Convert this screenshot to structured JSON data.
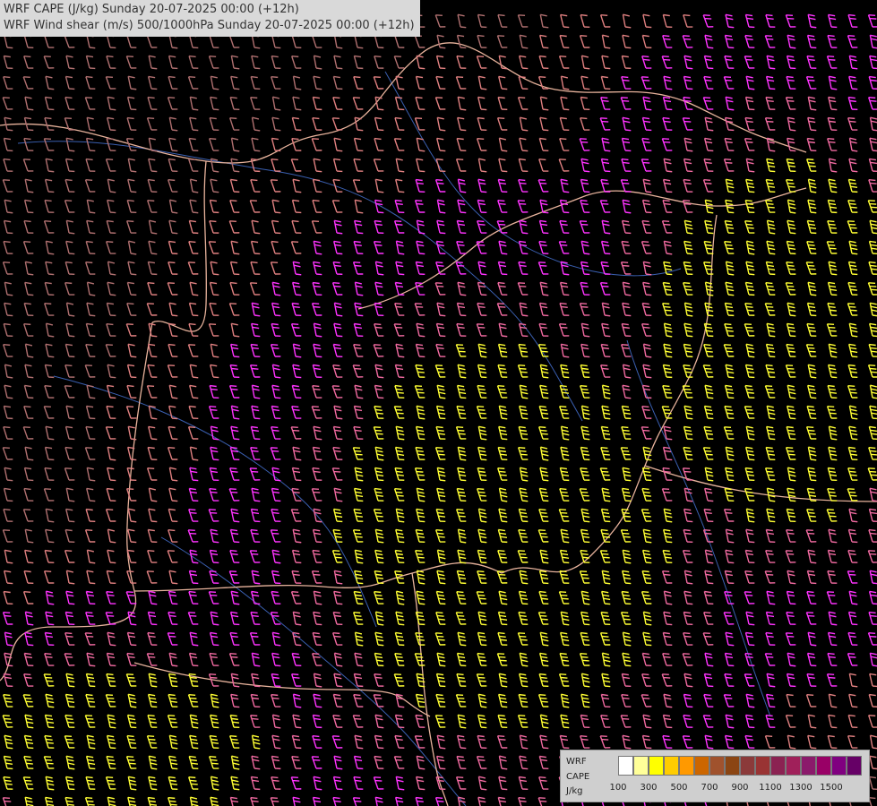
{
  "titles": {
    "line1": "WRF CAPE (J/kg) Sunday 20-07-2025 00:00 (+12h)",
    "line2": "WRF Wind shear (m/s) 500/1000hPa Sunday 20-07-2025 00:00 (+12h)"
  },
  "legend": {
    "label_lines": [
      "WRF",
      "CAPE",
      "J/kg"
    ],
    "colors": [
      "#ffffff",
      "#ffff99",
      "#ffff00",
      "#ffcc00",
      "#ff9900",
      "#cc6600",
      "#a0522d",
      "#8b4513",
      "#8b3a3a",
      "#993333",
      "#8b2252",
      "#a0205a",
      "#8b1a6b",
      "#990066",
      "#800080",
      "#660066"
    ],
    "tick_labels": [
      "100",
      "300",
      "500",
      "700",
      "900",
      "1100",
      "1300",
      "1500"
    ]
  },
  "map_style": {
    "background": "#000000",
    "border_color": "#e8b39c",
    "river_color": "#3a5fb0",
    "barb_colors": [
      "#b07070",
      "#e08080",
      "#f06aa0",
      "#ff33ff",
      "#ffff33"
    ]
  }
}
